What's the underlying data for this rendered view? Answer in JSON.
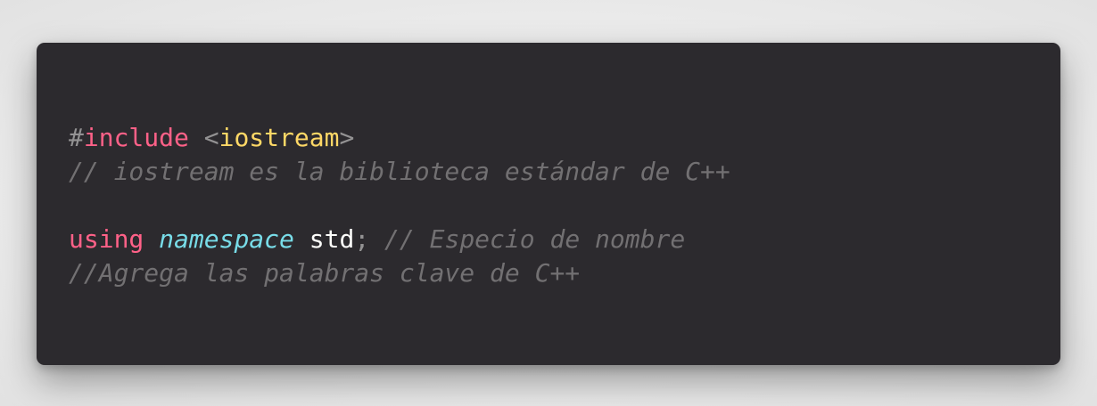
{
  "code": {
    "line1": {
      "hash": "#",
      "include": "include",
      "space": " ",
      "lt": "<",
      "header": "iostream",
      "gt": ">"
    },
    "line2": {
      "comment": "// iostream es la biblioteca estándar de C++"
    },
    "line4": {
      "using": "using",
      "sp1": " ",
      "namespace": "namespace",
      "sp2": " ",
      "std": "std",
      "semicolon": ";",
      "sp3": " ",
      "comment": "// Especio de nombre"
    },
    "line5": {
      "comment": "//Agrega las palabras clave de C++"
    }
  },
  "colors": {
    "background": "#2c2a2e",
    "keyword": "#ff6188",
    "string": "#ffd866",
    "type": "#78dce8",
    "identifier": "#fcfcfa",
    "comment": "#727072",
    "punctuation": "#939293"
  }
}
